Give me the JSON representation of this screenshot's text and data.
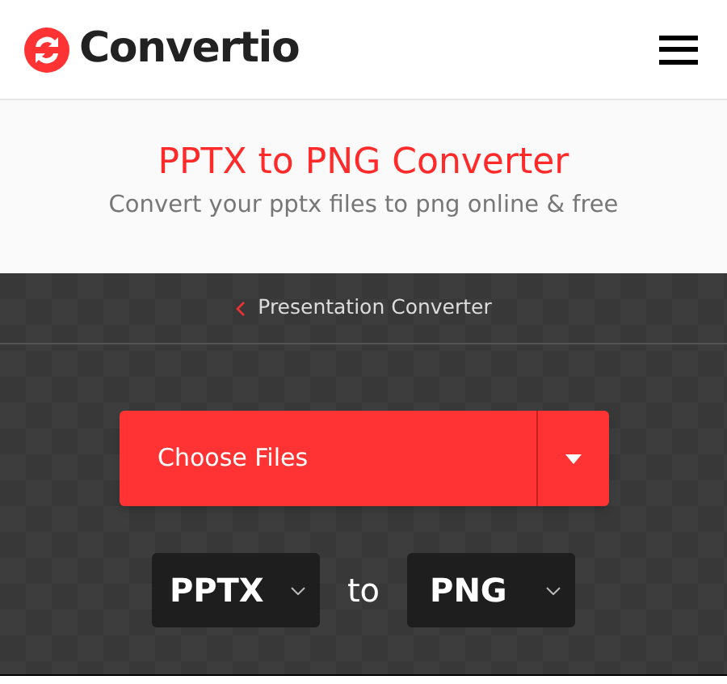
{
  "header": {
    "logo_text": "Convertio"
  },
  "hero": {
    "title": "PPTX to PNG Converter",
    "subtitle": "Convert your pptx files to png online & free"
  },
  "breadcrumb": {
    "label": "Presentation Converter"
  },
  "upload": {
    "button": "Choose Files"
  },
  "conversion": {
    "from": "PPTX",
    "separator": "to",
    "to": "PNG"
  }
}
